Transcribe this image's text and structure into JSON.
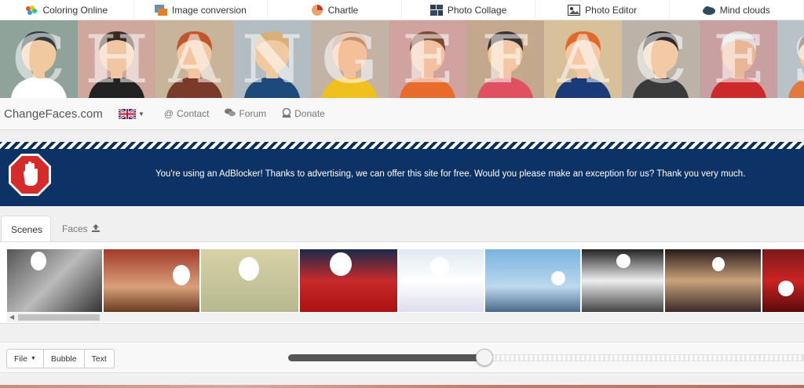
{
  "top_nav": {
    "items": [
      {
        "label": "Coloring Online",
        "icon": "palette-icon"
      },
      {
        "label": "Image conversion",
        "icon": "image-convert-icon"
      },
      {
        "label": "Chartle",
        "icon": "pie-chart-icon"
      },
      {
        "label": "Photo Collage",
        "icon": "collage-icon"
      },
      {
        "label": "Photo Editor",
        "icon": "photo-editor-icon"
      },
      {
        "label": "Mind clouds",
        "icon": "cloud-icon"
      }
    ]
  },
  "banner": {
    "letters": [
      "C",
      "H",
      "A",
      "N",
      "G",
      "E",
      "F",
      "A",
      "C",
      "E",
      "S"
    ]
  },
  "site_bar": {
    "brand": "ChangeFaces.com",
    "language_icon": "uk-flag-icon",
    "links": [
      {
        "label": "Contact",
        "icon": "at-icon"
      },
      {
        "label": "Forum",
        "icon": "chat-icon"
      },
      {
        "label": "Donate",
        "icon": "donate-icon"
      }
    ]
  },
  "adblock": {
    "message": "You're using an AdBlocker! Thanks to advertising, we can offer this site for free. Would you please make an exception for us? Thank you very much.",
    "icon": "stop-hand-icon"
  },
  "scenes": {
    "tabs": [
      {
        "label": "Scenes",
        "active": true
      },
      {
        "label": "Faces",
        "icon": "upload-icon",
        "active": false
      }
    ],
    "thumbnails": [
      "lincoln-statue-scene",
      "bartender-scene",
      "dollar-bill-scene",
      "football-player-scene",
      "angel-baby-scene",
      "yoga-beach-scene",
      "party-crowd-scene",
      "new-year-party-scene",
      "santa-scene"
    ]
  },
  "toolbar": {
    "file_label": "File",
    "bubble_label": "Bubble",
    "text_label": "Text",
    "zoom_fraction": 0.38
  },
  "colors": {
    "ad_background": "#0d3366",
    "stop_sign": "#d52b2b"
  }
}
